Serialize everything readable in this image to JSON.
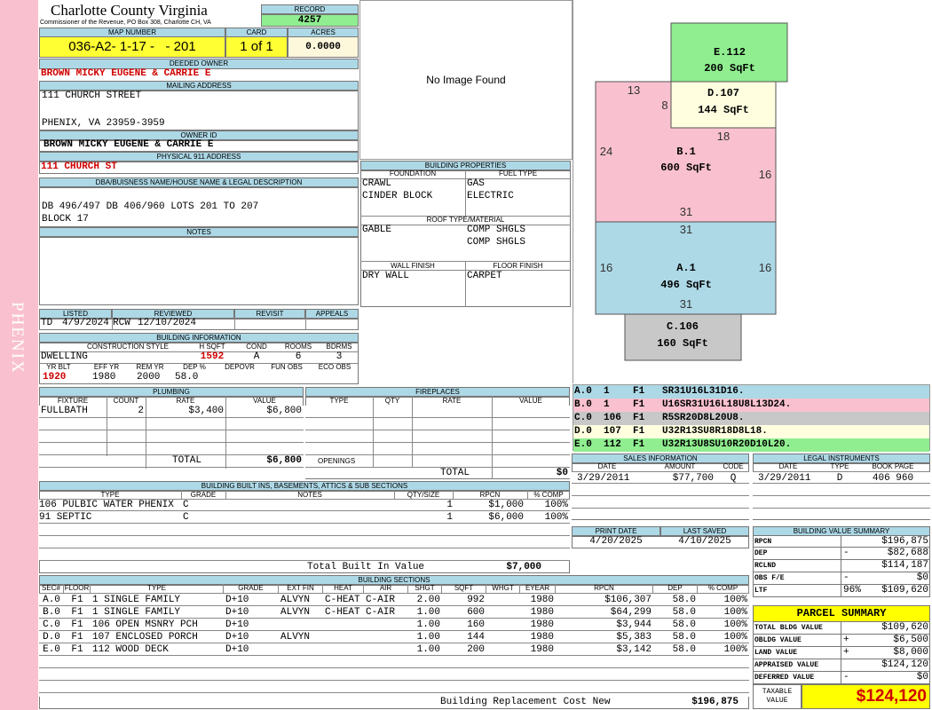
{
  "sidebar": {
    "label": "PHENIX"
  },
  "header": {
    "county": "Charlotte County Virginia",
    "office": "Commissioner of the Revenue, PO Box 308, Charlotte CH, VA",
    "record_label": "RECORD",
    "record": "4257"
  },
  "mapinfo": {
    "map_label": "MAP NUMBER",
    "map": "036-A2- 1-17 -   - 201",
    "card_label": "CARD",
    "card": "1 of 1",
    "acres_label": "ACRES",
    "acres": "0.0000"
  },
  "owner": {
    "deeded_label": "DEEDED OWNER",
    "deeded": "BROWN MICKY EUGENE & CARRIE E",
    "mailing_label": "MAILING ADDRESS",
    "addr1": "111 CHURCH STREET",
    "addr2": "PHENIX, VA 23959-3959",
    "owner_id_label": "OWNER ID",
    "owner_id": "BROWN MICKY EUGENE & CARRIE E",
    "phys_label": "PHYSICAL 911 ADDRESS",
    "phys": "111 CHURCH ST"
  },
  "legal": {
    "label": "DBA/BUISNESS NAME/HOUSE NAME & LEGAL DESCRIPTION",
    "line1": "DB 496/497 DB 406/960 LOTS 201 TO 207",
    "line2": "BLOCK 17",
    "notes_label": "NOTES"
  },
  "photo": {
    "text": "No Image Found"
  },
  "props": {
    "title": "BUILDING PROPERTIES",
    "foundation_h": "FOUNDATION",
    "fuel_h": "FUEL TYPE",
    "f1": "CRAWL",
    "f2": "CINDER BLOCK",
    "u1": "GAS",
    "u2": "ELECTRIC",
    "roof_h": "ROOF TYPE/MATERIAL",
    "roof": "GABLE",
    "rm1": "COMP SHGLS",
    "rm2": "COMP SHGLS",
    "wall_h": "WALL FINISH",
    "floor_h": "FLOOR FINISH",
    "wall": "DRY WALL",
    "floor": "CARPET"
  },
  "listed": {
    "listed_h": "LISTED",
    "reviewed_h": "REVIEWED",
    "revisit_h": "REVISIT",
    "appeals_h": "APPEALS",
    "l1": "TD",
    "l2": "4/9/2024",
    "r1": "RCW",
    "r2": "12/10/2024"
  },
  "bldg": {
    "title": "BUILDING INFORMATION",
    "cs_h": "CONSTRUCTION STYLE",
    "hsqft_h": "H SQFT",
    "cond_h": "COND",
    "rooms_h": "ROOMS",
    "bdrms_h": "BDRMS",
    "style": "DWELLING",
    "hsqft": "1592",
    "cond": "A",
    "rooms": "6",
    "bdrms": "3",
    "yb_h": "YR BLT",
    "eff_h": "EFF YR",
    "rem_h": "REM YR",
    "dep_h": "DEP %",
    "depovr_h": "DEPOVR",
    "fun_h": "FUN OBS",
    "eco_h": "ECO OBS",
    "yb": "1920",
    "eff": "1980",
    "rem": "2000",
    "dep": "58.0"
  },
  "plumb": {
    "title": "PLUMBING",
    "h": [
      "FIXTURE",
      "COUNT",
      "RATE",
      "VALUE"
    ],
    "rows": [
      [
        "FULLBATH",
        "2",
        "$3,400",
        "$6,800"
      ]
    ],
    "total_label": "TOTAL",
    "total": "$6,800"
  },
  "fire": {
    "title": "FIREPLACES",
    "h": [
      "TYPE",
      "QTY",
      "RATE",
      "VALUE"
    ],
    "openings": "OPENINGS",
    "total_label": "TOTAL",
    "total": "$0"
  },
  "builtins": {
    "title": "BUILDING BUILT INS, BASEMENTS, ATTICS & SUB SECTIONS",
    "h": [
      "TYPE",
      "GRADE",
      "NOTES",
      "QTY/SIZE",
      "RPCN",
      "% COMP"
    ],
    "rows": [
      [
        "106 PULBIC WATER PHENIX",
        "C",
        "",
        "1",
        "$1,000",
        "100%"
      ],
      [
        "91 SEPTIC",
        "C",
        "",
        "1",
        "$6,000",
        "100%"
      ]
    ],
    "total_label": "Total Built In Value",
    "total": "$7,000"
  },
  "sections": {
    "title": "BUILDING SECTIONS",
    "h": [
      "SEC#",
      "FLOOR",
      "TYPE",
      "GRADE",
      "EXT FIN",
      "HEAT",
      "AIR",
      "SHGT",
      "SQFT",
      "WHGT",
      "EYEAR",
      "RPCN",
      "DEP",
      "% COMP"
    ],
    "rows": [
      [
        "A.0",
        "F1",
        "1 SINGLE FAMILY",
        "D+10",
        "ALVYN",
        "C-HEAT",
        "C-AIR",
        "2.00",
        "992",
        "",
        "1980",
        "$106,307",
        "58.0",
        "100%"
      ],
      [
        "B.0",
        "F1",
        "1 SINGLE FAMILY",
        "D+10",
        "ALVYN",
        "C-HEAT",
        "C-AIR",
        "1.00",
        "600",
        "",
        "1980",
        "$64,299",
        "58.0",
        "100%"
      ],
      [
        "C.0",
        "F1",
        "106 OPEN MSNRY PCH",
        "D+10",
        "",
        "",
        "",
        "1.00",
        "160",
        "",
        "1980",
        "$3,944",
        "58.0",
        "100%"
      ],
      [
        "D.0",
        "F1",
        "107 ENCLOSED PORCH",
        "D+10",
        "ALVYN",
        "",
        "",
        "1.00",
        "144",
        "",
        "1980",
        "$5,383",
        "58.0",
        "100%"
      ],
      [
        "E.0",
        "F1",
        "112 WOOD DECK",
        "D+10",
        "",
        "",
        "",
        "1.00",
        "200",
        "",
        "1980",
        "$3,142",
        "58.0",
        "100%"
      ]
    ],
    "brcn_label": "Building Replacement Cost New",
    "brcn": "$196,875"
  },
  "sketch": {
    "e": {
      "name": "E.112",
      "sqft": "200 SqFt"
    },
    "d": {
      "name": "D.107",
      "sqft": "144 SqFt"
    },
    "b": {
      "name": "B.1",
      "sqft": "600 SqFt"
    },
    "a": {
      "name": "A.1",
      "sqft": "496 SqFt"
    },
    "c": {
      "name": "C.106",
      "sqft": "160 SqFt"
    },
    "dims": {
      "d13": "13",
      "d8": "8",
      "d18": "18",
      "d24": "24",
      "d16a": "16",
      "d31a": "31",
      "d31b": "31",
      "d16b": "16",
      "d16c": "16",
      "d31c": "31",
      "d31d": "31"
    },
    "colors": {
      "a": "#add8e6",
      "b": "#f9c1cf",
      "c": "#c8c8c8",
      "d": "#ffffe0",
      "e": "#90ee90"
    }
  },
  "vectors": [
    {
      "text": "A.0  1    F1   SR31U16L31D16.",
      "color": "#add8e6"
    },
    {
      "text": "B.0  1    F1   U16SR31U16L18U8L13D24.",
      "color": "#f9c1cf"
    },
    {
      "text": "C.0  106  F1   R5SR20D8L20U8.",
      "color": "#c8c8c8"
    },
    {
      "text": "D.0  107  F1   U32R13SU8R18D8L18.",
      "color": "#ffffe0"
    },
    {
      "text": "E.0  112  F1   U32R13U8SU10R20D10L20.",
      "color": "#90ee90"
    }
  ],
  "sales": {
    "title": "SALES INFORMATION",
    "h": [
      "DATE",
      "AMOUNT",
      "CODE"
    ],
    "row": [
      "3/29/2011",
      "$77,700",
      "Q"
    ]
  },
  "legalinst": {
    "title": "LEGAL INSTRUMENTS",
    "h": [
      "DATE",
      "TYPE",
      "BOOK PAGE"
    ],
    "row": [
      "3/29/2011",
      "D",
      "406 960"
    ]
  },
  "print": {
    "print_h": "PRINT DATE",
    "saved_h": "LAST SAVED",
    "print": "4/20/2025",
    "saved": "4/10/2025"
  },
  "bvs": {
    "title": "BUILDING VALUE SUMMARY",
    "rows": [
      [
        "RPCN",
        "",
        "$196,875"
      ],
      [
        "DEP",
        "-",
        "$82,688"
      ],
      [
        "RCLND",
        "",
        "$114,187"
      ],
      [
        "OBS F/E",
        "-",
        "$0"
      ],
      [
        "LTF",
        "96%",
        "$109,620"
      ]
    ]
  },
  "parcel": {
    "title": "PARCEL SUMMARY",
    "rows": [
      [
        "TOTAL BLDG VALUE",
        "",
        "$109,620"
      ],
      [
        "OBLDG VALUE",
        "+",
        "$6,500"
      ],
      [
        "LAND VALUE",
        "+",
        "$8,000"
      ],
      [
        "APPRAISED VALUE",
        "",
        "$124,120"
      ],
      [
        "DEFERRED VALUE",
        "-",
        "$0"
      ]
    ],
    "taxable_label1": "TAXABLE",
    "taxable_label2": "VALUE",
    "taxable": "$124,120"
  }
}
